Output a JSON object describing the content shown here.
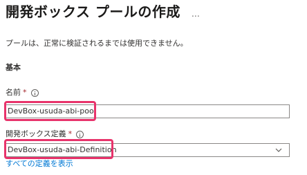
{
  "header": {
    "title": "開発ボックス プールの作成",
    "more_label": "…"
  },
  "description": "プールは、正常に検証されるまでは使用できません。",
  "section_title": "基本",
  "fields": {
    "name": {
      "label": "名前",
      "required_marker": "*",
      "value": "DevBox-usuda-abi-pool",
      "info_icon": "info-icon"
    },
    "definition": {
      "label": "開発ボックス定義",
      "required_marker": "*",
      "value": "DevBox-usuda-abi-Definition",
      "info_icon": "info-icon",
      "dropdown_icon": "chevron-down-icon"
    }
  },
  "link": {
    "view_all_definitions": "すべての定義を表示"
  },
  "colors": {
    "highlight": "#e8336b",
    "link": "#0078d4",
    "required": "#a4262c"
  }
}
